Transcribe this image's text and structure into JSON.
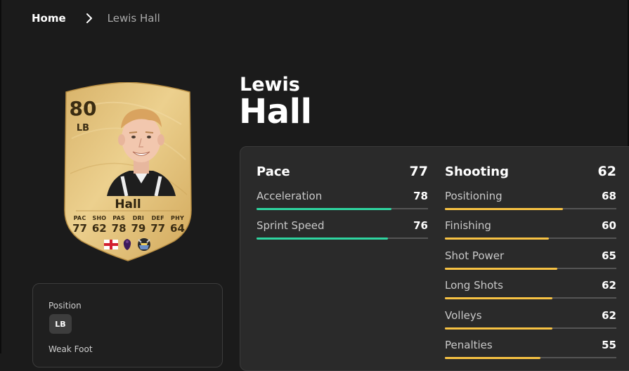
{
  "breadcrumb": {
    "home": "Home",
    "current": "Lewis Hall"
  },
  "card": {
    "rating": "80",
    "position": "LB",
    "name": "Hall",
    "stats": [
      {
        "label": "PAC",
        "value": "77"
      },
      {
        "label": "SHO",
        "value": "62"
      },
      {
        "label": "PAS",
        "value": "78"
      },
      {
        "label": "DRI",
        "value": "79"
      },
      {
        "label": "DEF",
        "value": "77"
      },
      {
        "label": "PHY",
        "value": "64"
      }
    ],
    "badges": [
      "england-flag-icon",
      "premier-league-icon",
      "newcastle-crest-icon"
    ]
  },
  "info": {
    "position_label": "Position",
    "position_value": "LB",
    "weak_foot_label": "Weak Foot"
  },
  "player": {
    "first_name": "Lewis",
    "last_name": "Hall"
  },
  "colors": {
    "green": "#2ed5a0",
    "yellow": "#f7c243",
    "card_gold": "#e2c17a"
  },
  "stat_groups": [
    {
      "title": "Pace",
      "value": "77",
      "color": "#2ed5a0",
      "rows": [
        {
          "name": "Acceleration",
          "value": "78"
        },
        {
          "name": "Sprint Speed",
          "value": "76"
        }
      ]
    },
    {
      "title": "Shooting",
      "value": "62",
      "color": "#f7c243",
      "rows": [
        {
          "name": "Positioning",
          "value": "68"
        },
        {
          "name": "Finishing",
          "value": "60"
        },
        {
          "name": "Shot Power",
          "value": "65"
        },
        {
          "name": "Long Shots",
          "value": "62"
        },
        {
          "name": "Volleys",
          "value": "62"
        },
        {
          "name": "Penalties",
          "value": "55"
        }
      ]
    }
  ]
}
